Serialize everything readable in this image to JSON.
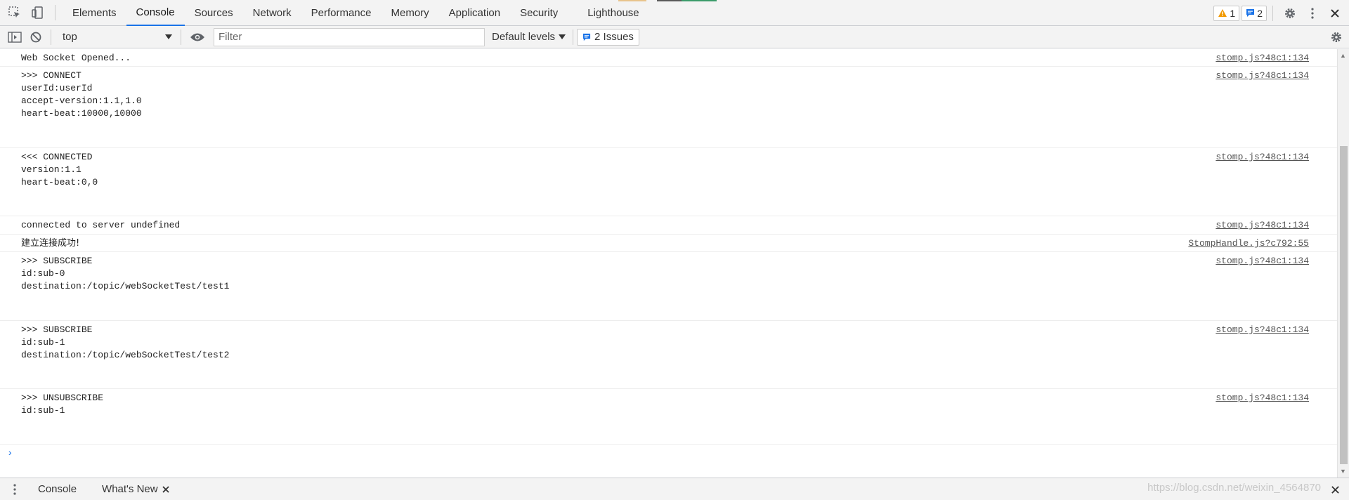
{
  "tabs": [
    {
      "label": "Elements"
    },
    {
      "label": "Console"
    },
    {
      "label": "Sources"
    },
    {
      "label": "Network"
    },
    {
      "label": "Performance"
    },
    {
      "label": "Memory"
    },
    {
      "label": "Application"
    },
    {
      "label": "Security"
    },
    {
      "label": "Lighthouse"
    }
  ],
  "badges": {
    "warnings": "1",
    "messages": "2"
  },
  "toolbar": {
    "context": "top",
    "filter_placeholder": "Filter",
    "levels": "Default levels",
    "issues": "2 Issues"
  },
  "messages": [
    {
      "text": "Web Socket Opened...",
      "source": "stomp.js?48c1:134"
    },
    {
      "text": ">>> CONNECT\nuserId:userId\naccept-version:1.1,1.0\nheart-beat:10000,10000\n\n\n",
      "source": "stomp.js?48c1:134"
    },
    {
      "text": "<<< CONNECTED\nversion:1.1\nheart-beat:0,0\n\n\n",
      "source": "stomp.js?48c1:134"
    },
    {
      "text": "connected to server undefined",
      "source": "stomp.js?48c1:134"
    },
    {
      "text": "建立连接成功!",
      "source": "StompHandle.js?c792:55"
    },
    {
      "text": ">>> SUBSCRIBE\nid:sub-0\ndestination:/topic/webSocketTest/test1\n\n\n",
      "source": "stomp.js?48c1:134"
    },
    {
      "text": ">>> SUBSCRIBE\nid:sub-1\ndestination:/topic/webSocketTest/test2\n\n\n",
      "source": "stomp.js?48c1:134"
    },
    {
      "text": ">>> UNSUBSCRIBE\nid:sub-1\n\n",
      "source": "stomp.js?48c1:134"
    }
  ],
  "drawer": {
    "console": "Console",
    "whats_new": "What's New"
  },
  "watermark": "https://blog.csdn.net/weixin_4564870",
  "colors": {
    "accent": "#1a73e8",
    "warning": "#f29900"
  }
}
